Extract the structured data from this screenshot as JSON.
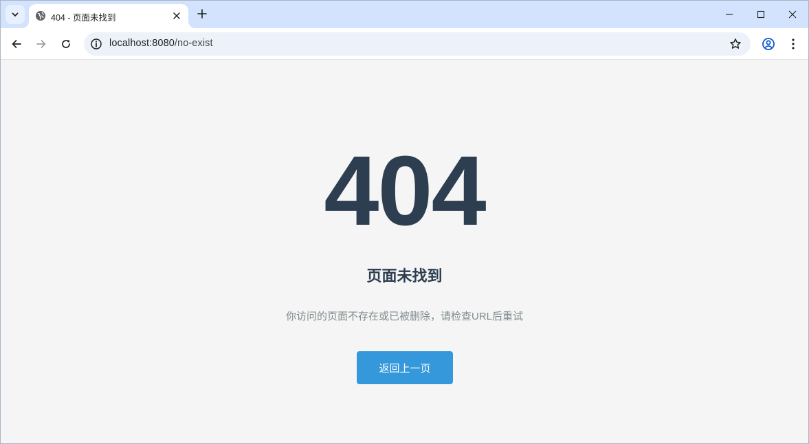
{
  "browser": {
    "tab": {
      "title": "404 - 页面未找到"
    },
    "address_bar": {
      "host": "localhost:8080",
      "path": "/no-exist"
    },
    "accent_color": "#d3e3fd"
  },
  "page": {
    "error_code": "404",
    "title": "页面未找到",
    "description": "你访问的页面不存在或已被删除，请检查URL后重试",
    "back_button_label": "返回上一页",
    "colors": {
      "heading": "#2c3e50",
      "description": "#7f8c8d",
      "button": "#3498db",
      "background": "#f5f5f5"
    }
  },
  "icons": {
    "tab_search": "chevron-down-icon",
    "favicon": "globe-icon",
    "tab_close": "close-icon",
    "new_tab": "plus-icon",
    "minimize": "minimize-icon",
    "maximize": "maximize-icon",
    "window_close": "close-icon",
    "back": "arrow-left-icon",
    "forward": "arrow-right-icon",
    "reload": "reload-icon",
    "site_info": "info-icon",
    "bookmark": "star-icon",
    "profile": "profile-icon",
    "menu": "more-vert-icon"
  }
}
